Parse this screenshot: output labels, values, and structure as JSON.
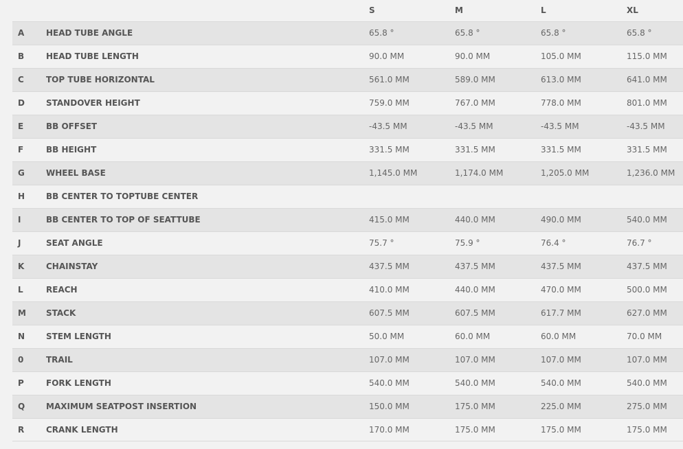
{
  "table": {
    "columns": [
      "S",
      "M",
      "L",
      "XL"
    ],
    "rows": [
      {
        "code": "A",
        "label": "HEAD TUBE ANGLE",
        "values": [
          "65.8 °",
          "65.8 °",
          "65.8 °",
          "65.8 °"
        ]
      },
      {
        "code": "B",
        "label": "HEAD TUBE LENGTH",
        "values": [
          "90.0 MM",
          "90.0 MM",
          "105.0 MM",
          "115.0 MM"
        ]
      },
      {
        "code": "C",
        "label": "TOP TUBE HORIZONTAL",
        "values": [
          "561.0 MM",
          "589.0 MM",
          "613.0 MM",
          "641.0 MM"
        ]
      },
      {
        "code": "D",
        "label": "STANDOVER HEIGHT",
        "values": [
          "759.0 MM",
          "767.0 MM",
          "778.0 MM",
          "801.0 MM"
        ]
      },
      {
        "code": "E",
        "label": "BB OFFSET",
        "values": [
          "-43.5 MM",
          "-43.5 MM",
          "-43.5 MM",
          "-43.5 MM"
        ]
      },
      {
        "code": "F",
        "label": "BB HEIGHT",
        "values": [
          "331.5 MM",
          "331.5 MM",
          "331.5 MM",
          "331.5 MM"
        ]
      },
      {
        "code": "G",
        "label": "WHEEL BASE",
        "values": [
          "1,145.0 MM",
          "1,174.0 MM",
          "1,205.0 MM",
          "1,236.0 MM"
        ]
      },
      {
        "code": "H",
        "label": "BB CENTER TO TOPTUBE CENTER",
        "values": [
          "",
          "",
          "",
          ""
        ]
      },
      {
        "code": "I",
        "label": "BB CENTER TO TOP OF SEATTUBE",
        "values": [
          "415.0 MM",
          "440.0 MM",
          "490.0 MM",
          "540.0 MM"
        ]
      },
      {
        "code": "J",
        "label": "SEAT ANGLE",
        "values": [
          "75.7 °",
          "75.9 °",
          "76.4 °",
          "76.7 °"
        ]
      },
      {
        "code": "K",
        "label": "CHAINSTAY",
        "values": [
          "437.5 MM",
          "437.5 MM",
          "437.5 MM",
          "437.5 MM"
        ]
      },
      {
        "code": "L",
        "label": "REACH",
        "values": [
          "410.0 MM",
          "440.0 MM",
          "470.0 MM",
          "500.0 MM"
        ]
      },
      {
        "code": "M",
        "label": "STACK",
        "values": [
          "607.5 MM",
          "607.5 MM",
          "617.7 MM",
          "627.0 MM"
        ]
      },
      {
        "code": "N",
        "label": "STEM LENGTH",
        "values": [
          "50.0 MM",
          "60.0 MM",
          "60.0 MM",
          "70.0 MM"
        ]
      },
      {
        "code": "0",
        "label": "TRAIL",
        "values": [
          "107.0 MM",
          "107.0 MM",
          "107.0 MM",
          "107.0 MM"
        ]
      },
      {
        "code": "P",
        "label": "FORK LENGTH",
        "values": [
          "540.0 MM",
          "540.0 MM",
          "540.0 MM",
          "540.0 MM"
        ]
      },
      {
        "code": "Q",
        "label": "MAXIMUM SEATPOST INSERTION",
        "values": [
          "150.0 MM",
          "175.0 MM",
          "225.0 MM",
          "275.0 MM"
        ]
      },
      {
        "code": "R",
        "label": "CRANK LENGTH",
        "values": [
          "170.0 MM",
          "175.0 MM",
          "175.0 MM",
          "175.0 MM"
        ]
      }
    ]
  }
}
